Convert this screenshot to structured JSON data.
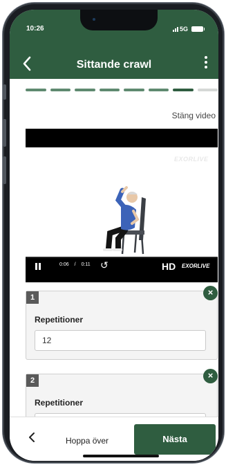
{
  "status_bar": {
    "time": "10:26",
    "network": "5G"
  },
  "header": {
    "title": "Sittande crawl"
  },
  "progress": {
    "completed": 6,
    "current": 7,
    "total": 8
  },
  "video": {
    "close_label": "Stäng video",
    "watermark": "EXORLIVE",
    "current_time": "0:06",
    "separator": "/",
    "duration": "0:11",
    "quality": "HD",
    "brand": "EXORLIVE"
  },
  "sets": [
    {
      "number": "1",
      "label": "Repetitioner",
      "value": "12"
    },
    {
      "number": "2",
      "label": "Repetitioner",
      "value": ""
    }
  ],
  "footer": {
    "skip_label": "Hoppa över",
    "next_label": "Nästa"
  },
  "colors": {
    "primary": "#2f5d40",
    "progress_done": "#5f8a70",
    "progress_todo": "#d5d8d6"
  }
}
